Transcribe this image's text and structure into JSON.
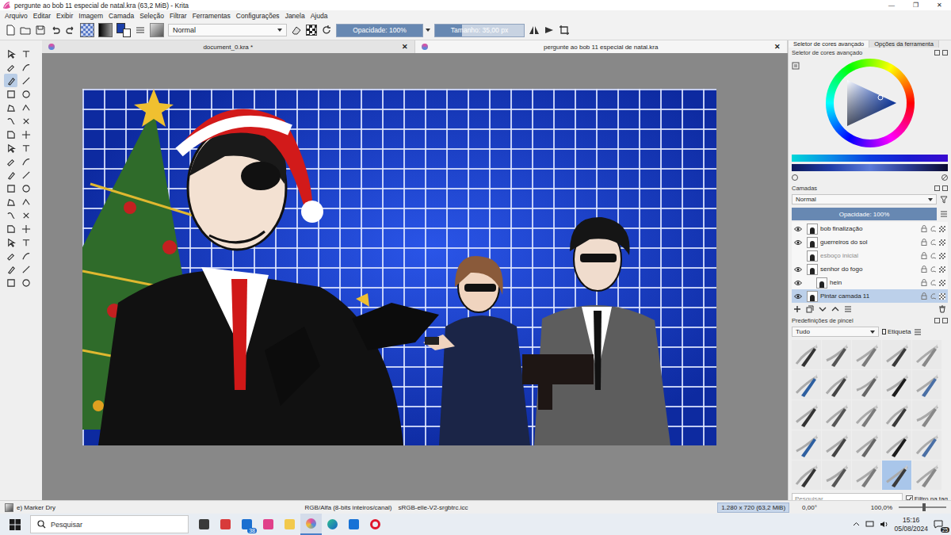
{
  "window": {
    "title": "pergunte ao bob 11 especial de natal.kra (63,2 MiB) - Krita",
    "controls": [
      "—",
      "❐",
      "✕"
    ]
  },
  "menu": [
    "Arquivo",
    "Editar",
    "Exibir",
    "Imagem",
    "Camada",
    "Seleção",
    "Filtrar",
    "Ferramentas",
    "Configurações",
    "Janela",
    "Ajuda"
  ],
  "toolbar": {
    "blend_mode": "Normal",
    "opacity": {
      "label": "Opacidade: 100%",
      "level": 1
    },
    "size": {
      "label": "Tamanho: 35,00 px",
      "level": 0.3
    }
  },
  "toolbox": {
    "tools": [
      {
        "selected": false
      },
      {
        "selected": false
      },
      {
        "selected": false
      },
      {
        "selected": false
      },
      {
        "selected": true
      },
      {
        "selected": false
      },
      {
        "selected": false
      },
      {
        "selected": false
      },
      {
        "selected": false
      },
      {
        "selected": false
      },
      {
        "selected": false
      },
      {
        "selected": false
      },
      {
        "selected": false
      },
      {
        "selected": false
      },
      {
        "selected": false
      },
      {
        "selected": false
      },
      {
        "selected": false
      },
      {
        "selected": false
      },
      {
        "selected": false
      },
      {
        "selected": false
      },
      {
        "selected": false
      },
      {
        "selected": false
      },
      {
        "selected": false
      },
      {
        "selected": false
      },
      {
        "selected": false
      },
      {
        "selected": false
      },
      {
        "selected": false
      },
      {
        "selected": false
      },
      {
        "selected": false
      },
      {
        "selected": false
      },
      {
        "selected": false
      },
      {
        "selected": false
      },
      {
        "selected": false
      },
      {
        "selected": false
      },
      {
        "selected": false
      },
      {
        "selected": false
      }
    ]
  },
  "document_tabs": [
    {
      "label": "document_0.kra *",
      "selected": false,
      "close": "✕"
    },
    {
      "label": "pergunte ao bob 11 especial de natal.kra",
      "selected": true,
      "close": "✕"
    }
  ],
  "docker_tabs": [
    {
      "label": "Seletor de cores avançado",
      "selected": true
    },
    {
      "label": "Opções da ferramenta",
      "selected": false
    }
  ],
  "color_selector": {
    "title": "Seletor de cores avançado"
  },
  "layers": {
    "title": "Camadas",
    "blend_mode": "Normal",
    "opacity": {
      "label": "Opacidade: 100%",
      "level": 1
    },
    "items": [
      {
        "name": "bob finalização",
        "visible": true,
        "selected": false,
        "child": false
      },
      {
        "name": "guerreiros do sol",
        "visible": true,
        "selected": false,
        "child": false
      },
      {
        "name": "esboço inicial",
        "visible": false,
        "selected": false,
        "child": false
      },
      {
        "name": "senhor do fogo",
        "visible": true,
        "selected": false,
        "child": false
      },
      {
        "name": "hein",
        "visible": true,
        "selected": false,
        "child": true
      },
      {
        "name": "Pintar camada 11",
        "visible": true,
        "selected": true,
        "child": false
      }
    ]
  },
  "brush_presets": {
    "title": "Predefinições de pincel",
    "filter": "Tudo",
    "tag_label": "Etiqueta",
    "search_placeholder": "Pesquisar",
    "filter_in_tag": {
      "label": "Filtro na tag",
      "checked": true
    },
    "items": [
      {
        "selected": false
      },
      {
        "selected": false
      },
      {
        "selected": false
      },
      {
        "selected": false
      },
      {
        "selected": false
      },
      {
        "selected": false
      },
      {
        "selected": false
      },
      {
        "selected": false
      },
      {
        "selected": false
      },
      {
        "selected": false
      },
      {
        "selected": false
      },
      {
        "selected": false
      },
      {
        "selected": false
      },
      {
        "selected": false
      },
      {
        "selected": false
      },
      {
        "selected": false
      },
      {
        "selected": false
      },
      {
        "selected": false
      },
      {
        "selected": false
      },
      {
        "selected": false
      },
      {
        "selected": false
      },
      {
        "selected": false
      },
      {
        "selected": false
      },
      {
        "selected": true
      },
      {
        "selected": false
      }
    ]
  },
  "status_bar": {
    "brush": "e) Marker Dry",
    "color_space": "RGB/Alfa (8-bits inteiros/canal)",
    "profile": "sRGB-elle-V2-srgbtrc.icc",
    "image_size": "1.280 x 720 (63,2 MiB)",
    "rotation": "0,00°",
    "zoom": "100,0%",
    "zoom_level": 0.5
  },
  "taskbar": {
    "search_placeholder": "Pesquisar",
    "mail_badge": "38",
    "time": "15:16",
    "date": "05/08/2024",
    "notifications": "25"
  }
}
